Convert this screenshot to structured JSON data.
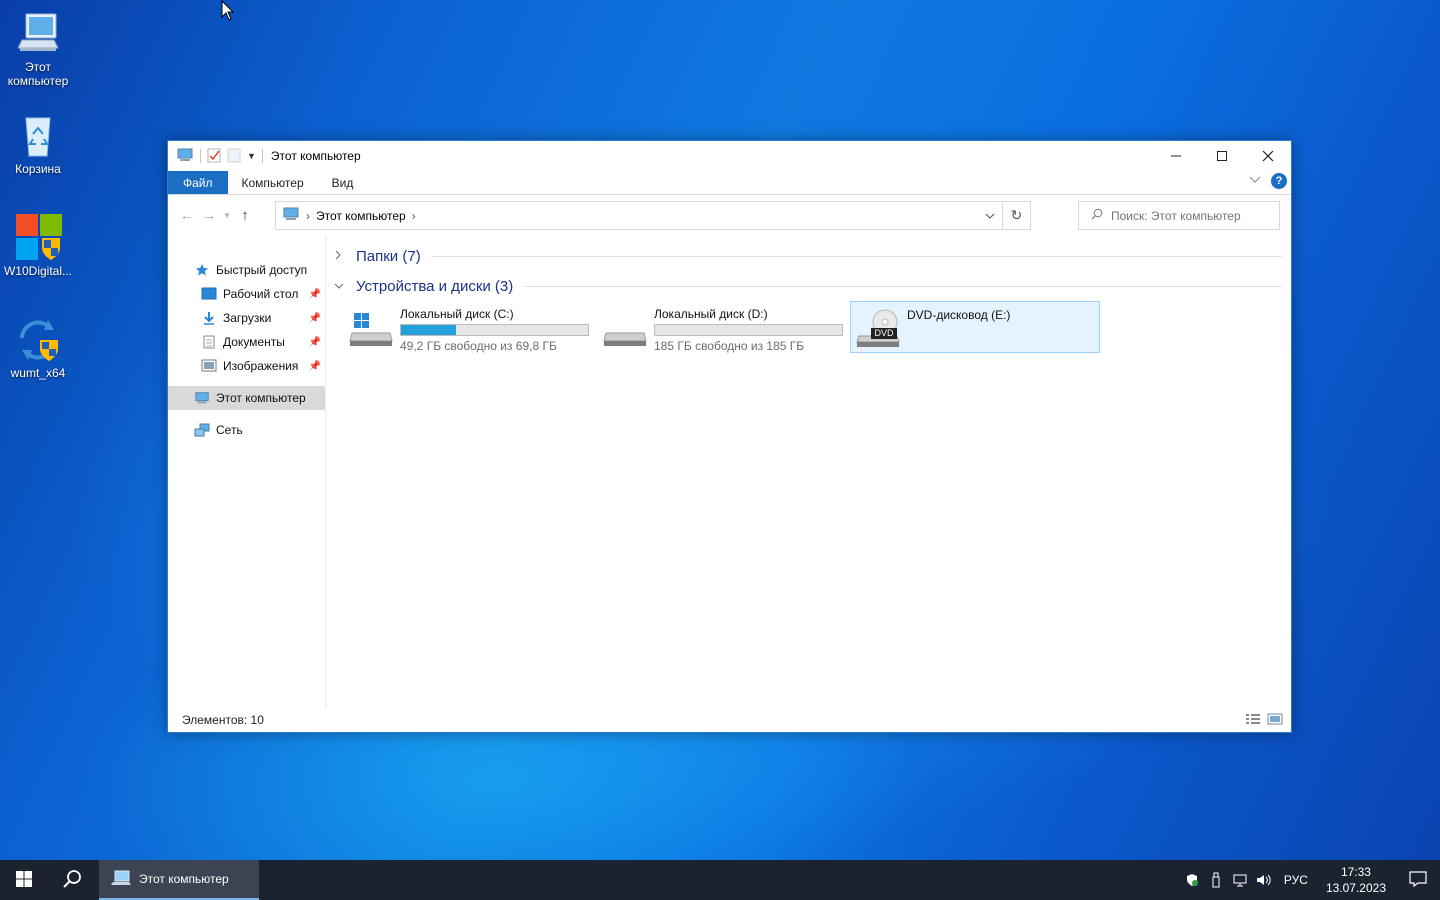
{
  "desktop": {
    "icons": [
      {
        "label": "Этот компьютер",
        "icon": "computer-icon"
      },
      {
        "label": "Корзина",
        "icon": "recycle-bin-icon"
      },
      {
        "label": "W10Digital...",
        "icon": "windows-shield-app-icon"
      },
      {
        "label": "wumt_x64",
        "icon": "update-shield-app-icon"
      }
    ]
  },
  "window": {
    "title": "Этот компьютер",
    "ribbon_tabs": [
      "Файл",
      "Компьютер",
      "Вид"
    ],
    "address": {
      "crumb": "Этот компьютер"
    },
    "search": {
      "placeholder": "Поиск: Этот компьютер"
    },
    "nav": {
      "quick_access": "Быстрый доступ",
      "pinned": [
        "Рабочий стол",
        "Загрузки",
        "Документы",
        "Изображения"
      ],
      "this_pc": "Этот компьютер",
      "network": "Сеть"
    },
    "groups": {
      "folders": "Папки (7)",
      "devices": "Устройства и диски (3)"
    },
    "drives": [
      {
        "name": "Локальный диск (C:)",
        "free": "49,2 ГБ свободно из 69,8 ГБ",
        "used_fraction": 0.295
      },
      {
        "name": "Локальный диск (D:)",
        "free": "185 ГБ свободно из 185 ГБ",
        "used_fraction": 0.0
      },
      {
        "name": "DVD-дисковод (E:)",
        "badge": "DVD"
      }
    ],
    "status": "Элементов: 10"
  },
  "taskbar": {
    "app_label": "Этот компьютер",
    "lang": "РУС",
    "time": "17:33",
    "date": "13.07.2023"
  },
  "colors": {
    "accent": "#1a6fc4",
    "drive_bar": "#26a0da",
    "taskbar": "#1c2330"
  }
}
